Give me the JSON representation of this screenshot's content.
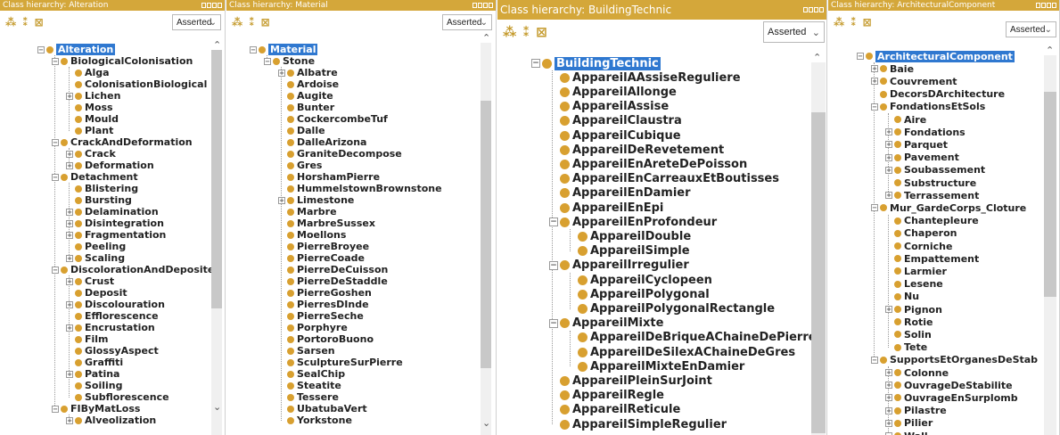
{
  "mode_label": "Asserted",
  "panels": [
    {
      "title": "Class hierarchy: Alteration",
      "rows": [
        {
          "label": "Alteration",
          "d": 0,
          "exp": "-",
          "sel": true
        },
        {
          "label": "BiologicalColonisation",
          "d": 1,
          "exp": "-"
        },
        {
          "label": "Alga",
          "d": 2
        },
        {
          "label": "ColonisationBiological",
          "d": 2
        },
        {
          "label": "Lichen",
          "d": 2,
          "exp": "+"
        },
        {
          "label": "Moss",
          "d": 2
        },
        {
          "label": "Mould",
          "d": 2
        },
        {
          "label": "Plant",
          "d": 2
        },
        {
          "label": "CrackAndDeformation",
          "d": 1,
          "exp": "-"
        },
        {
          "label": "Crack",
          "d": 2,
          "exp": "+"
        },
        {
          "label": "Deformation",
          "d": 2,
          "exp": "+"
        },
        {
          "label": "Detachment",
          "d": 1,
          "exp": "-"
        },
        {
          "label": "Blistering",
          "d": 2
        },
        {
          "label": "Bursting",
          "d": 2
        },
        {
          "label": "Delamination",
          "d": 2,
          "exp": "+"
        },
        {
          "label": "Disintegration",
          "d": 2,
          "exp": "+"
        },
        {
          "label": "Fragmentation",
          "d": 2,
          "exp": "+"
        },
        {
          "label": "Peeling",
          "d": 2
        },
        {
          "label": "Scaling",
          "d": 2,
          "exp": "+"
        },
        {
          "label": "DiscolorationAndDeposite",
          "d": 1,
          "exp": "-"
        },
        {
          "label": "Crust",
          "d": 2,
          "exp": "+"
        },
        {
          "label": "Deposit",
          "d": 2
        },
        {
          "label": "Discolouration",
          "d": 2,
          "exp": "+"
        },
        {
          "label": "Efflorescence",
          "d": 2
        },
        {
          "label": "Encrustation",
          "d": 2,
          "exp": "+"
        },
        {
          "label": "Film",
          "d": 2
        },
        {
          "label": "GlossyAspect",
          "d": 2
        },
        {
          "label": "Graffiti",
          "d": 2
        },
        {
          "label": "Patina",
          "d": 2,
          "exp": "+"
        },
        {
          "label": "Soiling",
          "d": 2
        },
        {
          "label": "Subflorescence",
          "d": 2
        },
        {
          "label": "FIByMatLoss",
          "d": 1,
          "exp": "-"
        },
        {
          "label": "Alveolization",
          "d": 2,
          "exp": "+"
        }
      ]
    },
    {
      "title": "Class hierarchy: Material",
      "rows": [
        {
          "label": "Material",
          "d": 0,
          "exp": "-",
          "sel": true
        },
        {
          "label": "Stone",
          "d": 1,
          "exp": "-"
        },
        {
          "label": "Albatre",
          "d": 2,
          "exp": "+"
        },
        {
          "label": "Ardoise",
          "d": 2
        },
        {
          "label": "Augite",
          "d": 2
        },
        {
          "label": "Bunter",
          "d": 2
        },
        {
          "label": "CockercombeTuf",
          "d": 2
        },
        {
          "label": "Dalle",
          "d": 2
        },
        {
          "label": "DalleArizona",
          "d": 2
        },
        {
          "label": "GraniteDecompose",
          "d": 2
        },
        {
          "label": "Gres",
          "d": 2
        },
        {
          "label": "HorshamPierre",
          "d": 2
        },
        {
          "label": "HummelstownBrownstone",
          "d": 2
        },
        {
          "label": "Limestone",
          "d": 2,
          "exp": "+"
        },
        {
          "label": "Marbre",
          "d": 2
        },
        {
          "label": "MarbreSussex",
          "d": 2
        },
        {
          "label": "Moellons",
          "d": 2
        },
        {
          "label": "PierreBroyee",
          "d": 2
        },
        {
          "label": "PierreCoade",
          "d": 2
        },
        {
          "label": "PierreDeCuisson",
          "d": 2
        },
        {
          "label": "PierreDeStaddle",
          "d": 2
        },
        {
          "label": "PierreGoshen",
          "d": 2
        },
        {
          "label": "PierresDInde",
          "d": 2
        },
        {
          "label": "PierreSeche",
          "d": 2
        },
        {
          "label": "Porphyre",
          "d": 2
        },
        {
          "label": "PortoroBuono",
          "d": 2
        },
        {
          "label": "Sarsen",
          "d": 2
        },
        {
          "label": "SculptureSurPierre",
          "d": 2
        },
        {
          "label": "SealChip",
          "d": 2
        },
        {
          "label": "Steatite",
          "d": 2
        },
        {
          "label": "Tessere",
          "d": 2
        },
        {
          "label": "UbatubaVert",
          "d": 2
        },
        {
          "label": "Yorkstone",
          "d": 2
        }
      ]
    },
    {
      "title": "Class hierarchy: BuildingTechnic",
      "rows": [
        {
          "label": "BuildingTechnic",
          "d": 0,
          "exp": "-",
          "sel": true
        },
        {
          "label": "AppareilAAssiseReguliere",
          "d": 1
        },
        {
          "label": "AppareilAllonge",
          "d": 1
        },
        {
          "label": "AppareilAssise",
          "d": 1
        },
        {
          "label": "AppareilClaustra",
          "d": 1
        },
        {
          "label": "AppareilCubique",
          "d": 1
        },
        {
          "label": "AppareilDeRevetement",
          "d": 1
        },
        {
          "label": "AppareilEnAreteDePoisson",
          "d": 1
        },
        {
          "label": "AppareilEnCarreauxEtBoutisses",
          "d": 1
        },
        {
          "label": "AppareilEnDamier",
          "d": 1
        },
        {
          "label": "AppareilEnEpi",
          "d": 1
        },
        {
          "label": "AppareilEnProfondeur",
          "d": 1,
          "exp": "-"
        },
        {
          "label": "AppareilDouble",
          "d": 2
        },
        {
          "label": "AppareilSimple",
          "d": 2
        },
        {
          "label": "AppareilIrregulier",
          "d": 1,
          "exp": "-"
        },
        {
          "label": "AppareilCyclopeen",
          "d": 2
        },
        {
          "label": "AppareilPolygonal",
          "d": 2
        },
        {
          "label": "AppareilPolygonalRectangle",
          "d": 2
        },
        {
          "label": "AppareilMixte",
          "d": 1,
          "exp": "-"
        },
        {
          "label": "AppareilDeBriqueAChaineDePierre",
          "d": 2
        },
        {
          "label": "AppareilDeSilexAChaineDeGres",
          "d": 2
        },
        {
          "label": "AppareilMixteEnDamier",
          "d": 2
        },
        {
          "label": "AppareilPleinSurJoint",
          "d": 1
        },
        {
          "label": "AppareilRegle",
          "d": 1
        },
        {
          "label": "AppareilReticule",
          "d": 1
        },
        {
          "label": "AppareilSimpleRegulier",
          "d": 1
        }
      ]
    },
    {
      "title": "Class hierarchy: ArchitecturalComponent",
      "rows": [
        {
          "label": "ArchitecturalComponent",
          "d": 0,
          "exp": "-",
          "sel": true
        },
        {
          "label": "Baie",
          "d": 1,
          "exp": "+"
        },
        {
          "label": "Couvrement",
          "d": 1,
          "exp": "+"
        },
        {
          "label": "DecorsDArchitecture",
          "d": 1
        },
        {
          "label": "FondationsEtSols",
          "d": 1,
          "exp": "-"
        },
        {
          "label": "Aire",
          "d": 2
        },
        {
          "label": "Fondations",
          "d": 2,
          "exp": "+"
        },
        {
          "label": "Parquet",
          "d": 2,
          "exp": "+"
        },
        {
          "label": "Pavement",
          "d": 2,
          "exp": "+"
        },
        {
          "label": "Soubassement",
          "d": 2,
          "exp": "+"
        },
        {
          "label": "Substructure",
          "d": 2
        },
        {
          "label": "Terrassement",
          "d": 2,
          "exp": "+"
        },
        {
          "label": "Mur_GardeCorps_Cloture",
          "d": 1,
          "exp": "-"
        },
        {
          "label": "Chantepleure",
          "d": 2
        },
        {
          "label": "Chaperon",
          "d": 2
        },
        {
          "label": "Corniche",
          "d": 2
        },
        {
          "label": "Empattement",
          "d": 2
        },
        {
          "label": "Larmier",
          "d": 2
        },
        {
          "label": "Lesene",
          "d": 2
        },
        {
          "label": "Nu",
          "d": 2
        },
        {
          "label": "Pignon",
          "d": 2,
          "exp": "+"
        },
        {
          "label": "Rotie",
          "d": 2
        },
        {
          "label": "Solin",
          "d": 2
        },
        {
          "label": "Tete",
          "d": 2
        },
        {
          "label": "SupportsEtOrganesDeStab",
          "d": 1,
          "exp": "-"
        },
        {
          "label": "Colonne",
          "d": 2,
          "exp": "+"
        },
        {
          "label": "OuvrageDeStabilite",
          "d": 2,
          "exp": "+"
        },
        {
          "label": "OuvrageEnSurplomb",
          "d": 2,
          "exp": "+"
        },
        {
          "label": "Pilastre",
          "d": 2,
          "exp": "+"
        },
        {
          "label": "Pilier",
          "d": 2,
          "exp": "+"
        },
        {
          "label": "Wall",
          "d": 2,
          "exp": "-"
        }
      ]
    }
  ]
}
